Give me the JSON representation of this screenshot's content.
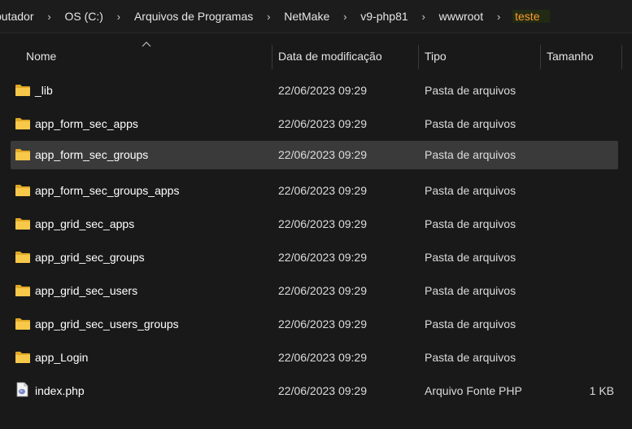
{
  "breadcrumb": {
    "items": [
      "putador",
      "OS (C:)",
      "Arquivos de Programas",
      "NetMake",
      "v9-php81",
      "wwwroot"
    ],
    "current": "teste",
    "separator": "›"
  },
  "columns": {
    "name": "Nome",
    "date": "Data de modificação",
    "type": "Tipo",
    "size": "Tamanho"
  },
  "rows": [
    {
      "name": "_lib",
      "date": "22/06/2023 09:29",
      "type": "Pasta de arquivos",
      "size": "",
      "icon": "folder-icon"
    },
    {
      "name": "app_form_sec_apps",
      "date": "22/06/2023 09:29",
      "type": "Pasta de arquivos",
      "size": "",
      "icon": "folder-icon"
    },
    {
      "name": "app_form_sec_groups",
      "date": "22/06/2023 09:29",
      "type": "Pasta de arquivos",
      "size": "",
      "icon": "folder-icon",
      "selected": true
    },
    {
      "name": "app_form_sec_groups_apps",
      "date": "22/06/2023 09:29",
      "type": "Pasta de arquivos",
      "size": "",
      "icon": "folder-icon"
    },
    {
      "name": "app_grid_sec_apps",
      "date": "22/06/2023 09:29",
      "type": "Pasta de arquivos",
      "size": "",
      "icon": "folder-icon"
    },
    {
      "name": "app_grid_sec_groups",
      "date": "22/06/2023 09:29",
      "type": "Pasta de arquivos",
      "size": "",
      "icon": "folder-icon"
    },
    {
      "name": "app_grid_sec_users",
      "date": "22/06/2023 09:29",
      "type": "Pasta de arquivos",
      "size": "",
      "icon": "folder-icon"
    },
    {
      "name": "app_grid_sec_users_groups",
      "date": "22/06/2023 09:29",
      "type": "Pasta de arquivos",
      "size": "",
      "icon": "folder-icon"
    },
    {
      "name": "app_Login",
      "date": "22/06/2023 09:29",
      "type": "Pasta de arquivos",
      "size": "",
      "icon": "folder-icon"
    },
    {
      "name": "index.php",
      "date": "22/06/2023 09:29",
      "type": "Arquivo Fonte PHP",
      "size": "1 KB",
      "icon": "php-file-icon"
    }
  ],
  "colors": {
    "background": "#191919",
    "selected_row": "#3a3a3a",
    "current_crumb": "#ff9a2e",
    "folder": "#f8c84a"
  }
}
